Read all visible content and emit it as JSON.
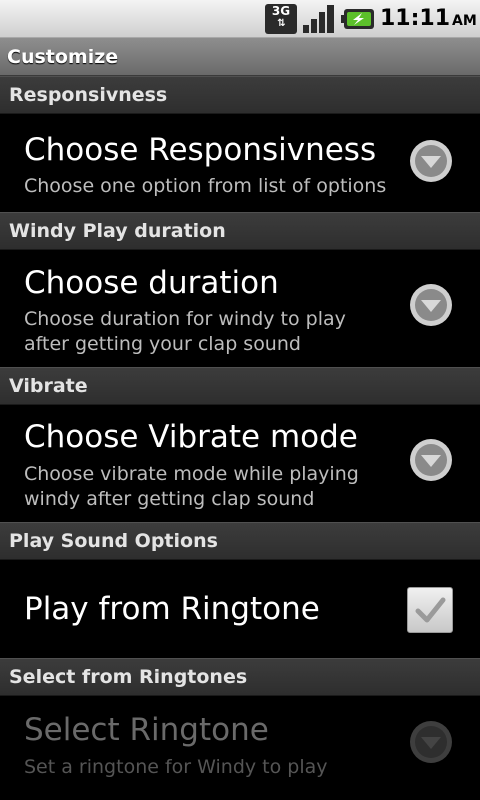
{
  "status_bar": {
    "network_label": "3G",
    "network_arrows": "⇅",
    "time": "11:11",
    "ampm": "AM",
    "battery_icon": "battery-charging-icon",
    "signal_icon": "signal-strength-icon"
  },
  "title_bar": {
    "title": "Customize"
  },
  "sections": [
    {
      "header": "Responsivness",
      "item": {
        "title": "Choose Responsivness",
        "summary": "Choose one option from list of options",
        "widget": "dropdown-arrow-icon"
      }
    },
    {
      "header": "Windy Play duration",
      "item": {
        "title": "Choose duration",
        "summary": "Choose duration for windy to play after getting your clap sound",
        "widget": "dropdown-arrow-icon"
      }
    },
    {
      "header": "Vibrate",
      "item": {
        "title": "Choose Vibrate mode",
        "summary": "Choose vibrate mode while playing windy after getting clap sound",
        "widget": "dropdown-arrow-icon"
      }
    },
    {
      "header": "Play Sound Options",
      "item": {
        "title": "Play from Ringtone",
        "summary": "",
        "widget": "checkbox",
        "checked": true
      }
    },
    {
      "header": "Select from Ringtones",
      "item": {
        "title": "Select Ringtone",
        "summary": "Set a ringtone for Windy to play",
        "widget": "dropdown-arrow-icon",
        "enabled": false
      }
    }
  ],
  "colors": {
    "background": "#000000",
    "category_bg": "#333333",
    "title_bar_bg": "#7a7a7a",
    "summary_text": "#bdbdbd",
    "disabled_text": "#6a6a6a",
    "check_color": "#9a9a9a"
  }
}
